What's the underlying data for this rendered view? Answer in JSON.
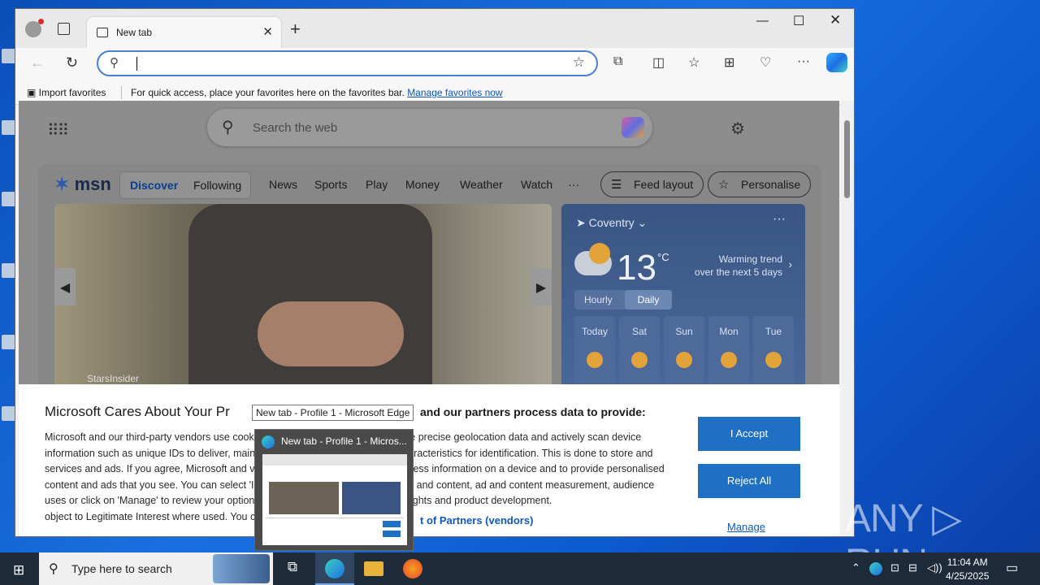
{
  "browser": {
    "tab_title": "New tab",
    "address_placeholder": "",
    "fav_import": "Import favorites",
    "fav_hint": "For quick access, place your favorites here on the favorites bar.",
    "fav_manage": "Manage favorites now"
  },
  "newtab": {
    "search_placeholder": "Search the web",
    "msn_logo": "msn",
    "nav": {
      "discover": "Discover",
      "following": "Following",
      "news": "News",
      "sports": "Sports",
      "play": "Play",
      "money": "Money",
      "weather": "Weather",
      "watch": "Watch",
      "more": "···"
    },
    "feed_layout": "Feed layout",
    "personalise": "Personalise",
    "hero_source": "StarsInsider"
  },
  "weather": {
    "location": "Coventry",
    "temperature": "13",
    "unit": "°C",
    "trend_line1": "Warming trend",
    "trend_line2": "over the next 5 days",
    "tab_hourly": "Hourly",
    "tab_daily": "Daily",
    "days": [
      "Today",
      "Sat",
      "Sun",
      "Mon",
      "Tue"
    ]
  },
  "consent": {
    "title": "Microsoft Cares About Your Pr",
    "title_right": "and our partners process data to provide:",
    "body": "Microsoft and our third-party vendors use cookies to store and access information such as unique IDs to deliver, maintain, and improve our services and ads. If you agree, Microsoft and vendors will personalise the content and ads that you see. You can select 'I Accept' to consent to these uses or click on 'Manage' to review your options and exercise your right to object to Legitimate Interest where used. You can change your selection",
    "body_right": "Use precise geolocation data and actively scan device characteristics for identification. This is done to store and access information on a device and to provide personalised ads and content, ad and content measurement, audience insights and product development.",
    "partners_link": "t of Partners (vendors)",
    "accept": "I Accept",
    "reject": "Reject All",
    "manage": "Manage"
  },
  "taskbar_preview": {
    "tooltip": "New tab - Profile 1 - Microsoft Edge",
    "title": "New tab - Profile 1 - Micros..."
  },
  "taskbar": {
    "search_placeholder": "Type here to search",
    "time": "11:04 AM",
    "date": "4/25/2025"
  },
  "watermark": "ANY ▷ RUN",
  "colors": {
    "accent": "#1f6fc5",
    "link": "#0f58b8",
    "taskbar": "#1c2a3a"
  }
}
